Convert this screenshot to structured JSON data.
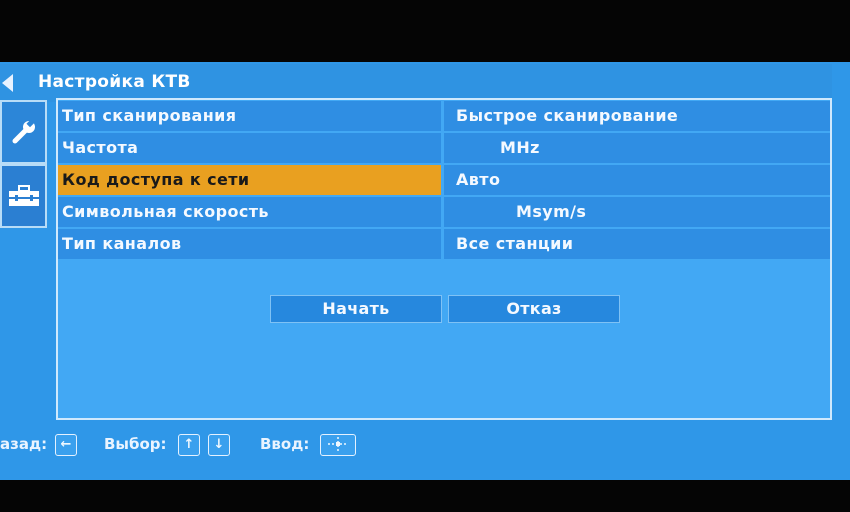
{
  "header": {
    "title": "Настройка КТВ"
  },
  "rows": [
    {
      "label": "Тип сканирования",
      "value": "Быстрое сканирование"
    },
    {
      "label": "Частота",
      "value": "MHz"
    },
    {
      "label": "Код доступа к сети",
      "value": "Авто"
    },
    {
      "label": "Символьная скорость",
      "value": "Msym/s"
    },
    {
      "label": "Тип каналов",
      "value": "Все станции"
    }
  ],
  "buttons": {
    "start": "Начать",
    "cancel": "Отказ"
  },
  "footer": {
    "back": "азад:",
    "select": "Выбор:",
    "enter": "Ввод:"
  },
  "colors": {
    "accent": "#e9a020",
    "background": "#42a8f4"
  }
}
